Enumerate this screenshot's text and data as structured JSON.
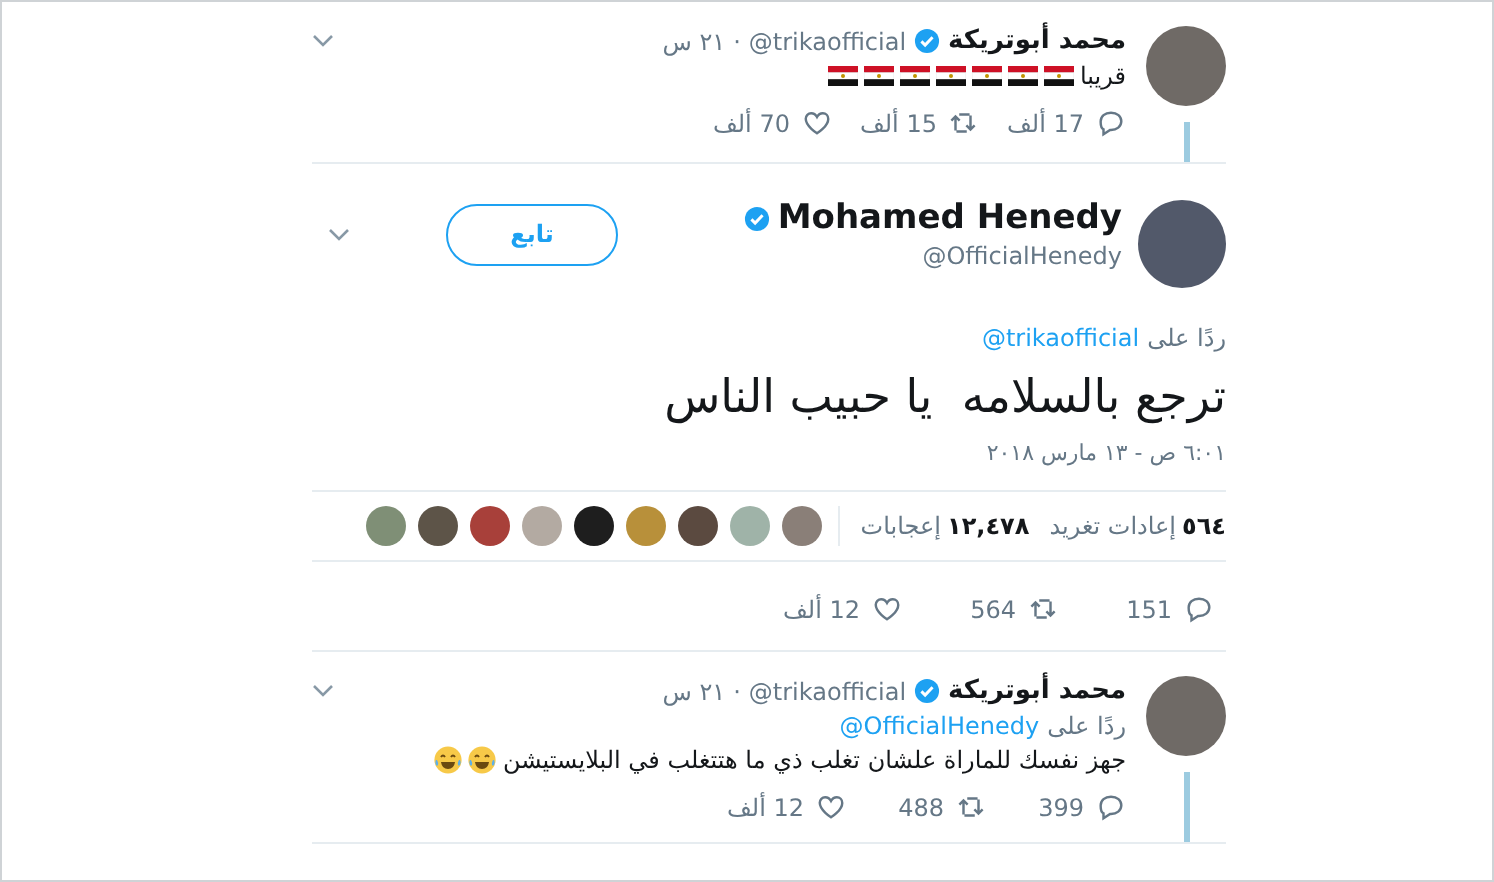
{
  "tweets": [
    {
      "kind": "compact",
      "author": {
        "name": "محمد أبوتريكة",
        "verified": true,
        "handle": "@trikaofficial"
      },
      "separator": "·",
      "time": "٢١ س",
      "thread_below": true,
      "text": "قريبا",
      "emoji": [
        {
          "kind": "flag"
        },
        {
          "kind": "flag"
        },
        {
          "kind": "flag"
        },
        {
          "kind": "flag"
        },
        {
          "kind": "flag"
        },
        {
          "kind": "flag"
        },
        {
          "kind": "flag"
        }
      ],
      "actions": [
        {
          "kind": "reply",
          "count": "17 ألف"
        },
        {
          "kind": "retweet",
          "count": "15 ألف"
        },
        {
          "kind": "like",
          "count": "70 ألف"
        }
      ]
    },
    {
      "kind": "focused",
      "author": {
        "name": "Mohamed Henedy",
        "verified": true,
        "handle": "@OfficialHenedy"
      },
      "follow_button": "تابع",
      "reply_label": "ردًا على",
      "reply_to": "@trikaofficial",
      "text": "ترجع بالسلامه  يا حبيب الناس",
      "date": "٦:٠١ ص - ١٣ مارس ٢٠١٨",
      "stats": [
        {
          "count": "٥٦٤",
          "label": "إعادات تغريد"
        },
        {
          "count": "١٢,٤٧٨",
          "label": "إعجابات"
        }
      ],
      "likers": [
        {
          "color": "#8a7f78"
        },
        {
          "color": "#9fb3a8"
        },
        {
          "color": "#5b4a40"
        },
        {
          "color": "#b8903a"
        },
        {
          "color": "#1e1e1e"
        },
        {
          "color": "#b3aaa2"
        },
        {
          "color": "#a8403a"
        },
        {
          "color": "#5d5448"
        },
        {
          "color": "#7f8f76"
        }
      ],
      "actions": [
        {
          "kind": "reply",
          "count": "151"
        },
        {
          "kind": "retweet",
          "count": "564"
        },
        {
          "kind": "like",
          "count": "12 ألف"
        }
      ]
    },
    {
      "kind": "compact",
      "author": {
        "name": "محمد أبوتريكة",
        "verified": true,
        "handle": "@trikaofficial"
      },
      "separator": "·",
      "time": "٢١ س",
      "thread_below": true,
      "reply_label": "ردًا على",
      "reply_to": "@OfficialHenedy",
      "text": "جهز نفسك للماراة علشان تغلب ذي ما هتتغلب في البلايستيشن",
      "emoji": [
        {
          "kind": "laughing"
        },
        {
          "kind": "laughing"
        }
      ],
      "actions": [
        {
          "kind": "reply",
          "count": "399"
        },
        {
          "kind": "retweet",
          "count": "488"
        },
        {
          "kind": "like",
          "count": "12 ألف"
        }
      ]
    }
  ]
}
